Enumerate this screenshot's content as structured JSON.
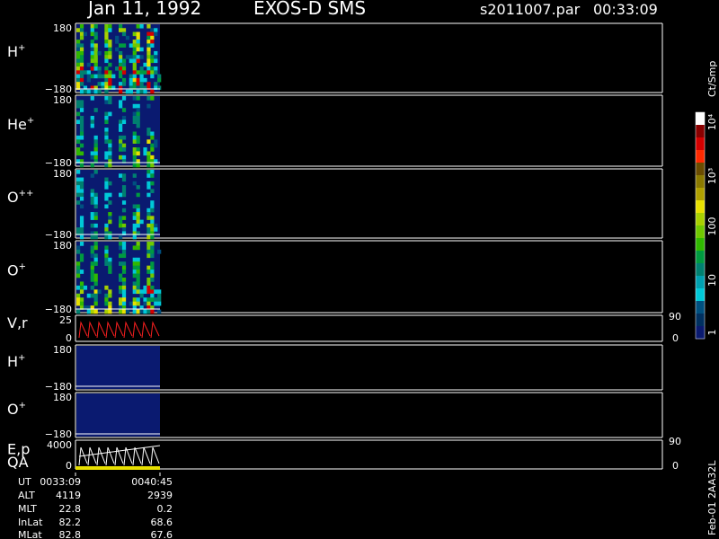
{
  "header": {
    "date": "Jan 11, 1992",
    "instrument": "EXOS-D SMS",
    "file": "s2011007.par",
    "time": "00:33:09"
  },
  "panels": [
    {
      "id": "h-plus",
      "label": "H",
      "sup": "+",
      "ytop": "180",
      "ybot": "−180",
      "type": "spectrogram",
      "intensity": 1.0
    },
    {
      "id": "he-plus",
      "label": "He",
      "sup": "+",
      "ytop": "180",
      "ybot": "−180",
      "type": "spectrogram",
      "intensity": 0.6
    },
    {
      "id": "o-plusplus",
      "label": "O",
      "sup": "++",
      "ytop": "180",
      "ybot": "−180",
      "type": "spectrogram",
      "intensity": 0.55
    },
    {
      "id": "o-plus",
      "label": "O",
      "sup": "+",
      "ytop": "180",
      "ybot": "−180",
      "type": "spectrogram",
      "intensity": 0.75
    },
    {
      "id": "vr",
      "label": "V,r",
      "sup": "",
      "ytop": "25",
      "ybot": "0",
      "rtop": "90",
      "rbot": "0",
      "type": "sawtooth-red"
    },
    {
      "id": "h-plus-2",
      "label": "H",
      "sup": "+",
      "ytop": "180",
      "ybot": "−180",
      "type": "spectrogram-low",
      "intensity": 0.15
    },
    {
      "id": "o-plus-2",
      "label": "O",
      "sup": "+",
      "ytop": "180",
      "ybot": "−180",
      "type": "spectrogram-low",
      "intensity": 0.08
    },
    {
      "id": "ep-qa",
      "label": "E,p",
      "label2": "QA",
      "sup": "",
      "ytop": "4000",
      "ybot": "0",
      "rtop": "90",
      "rbot": "0",
      "type": "sawtooth-white"
    }
  ],
  "colorbar": {
    "unit": "Ct/Smp",
    "labels": [
      "10⁴",
      "10³",
      "100",
      "10",
      "1"
    ],
    "colors": [
      "#ffffff",
      "#8b0000",
      "#d40000",
      "#ff2a00",
      "#6a4c00",
      "#8b7a00",
      "#b0a000",
      "#e8e000",
      "#a8d000",
      "#70c800",
      "#30b800",
      "#009a40",
      "#008070",
      "#00a0b0",
      "#00c8d8",
      "#005080",
      "#003060",
      "#0a1a70"
    ]
  },
  "footer": {
    "labels": [
      "UT",
      "ALT",
      "MLT",
      "InLat",
      "MLat"
    ],
    "col1": [
      "0033:09",
      "4119",
      "22.8",
      "82.2",
      "82.8"
    ],
    "col2": [
      "0040:45",
      "2939",
      "0.2",
      "68.6",
      "67.6"
    ],
    "side_label": "Feb-01 2AA32L"
  },
  "chart_data": {
    "type": "heatmap",
    "title": "Jan 11, 1992  EXOS-D SMS",
    "xlabel": "UT",
    "x_range": [
      "0033:09",
      "0040:45"
    ],
    "panels": [
      "H+",
      "He+",
      "O++",
      "O+",
      "V,r",
      "H+",
      "O+",
      "E,p QA"
    ],
    "ylim": [
      -180,
      180
    ],
    "colorbar_unit": "Ct/Smp",
    "colorbar_ticks": [
      "1",
      "10",
      "100",
      "10³",
      "10⁴"
    ],
    "data_coverage": "data only present at start of interval (approx. first 12% of time axis)"
  }
}
